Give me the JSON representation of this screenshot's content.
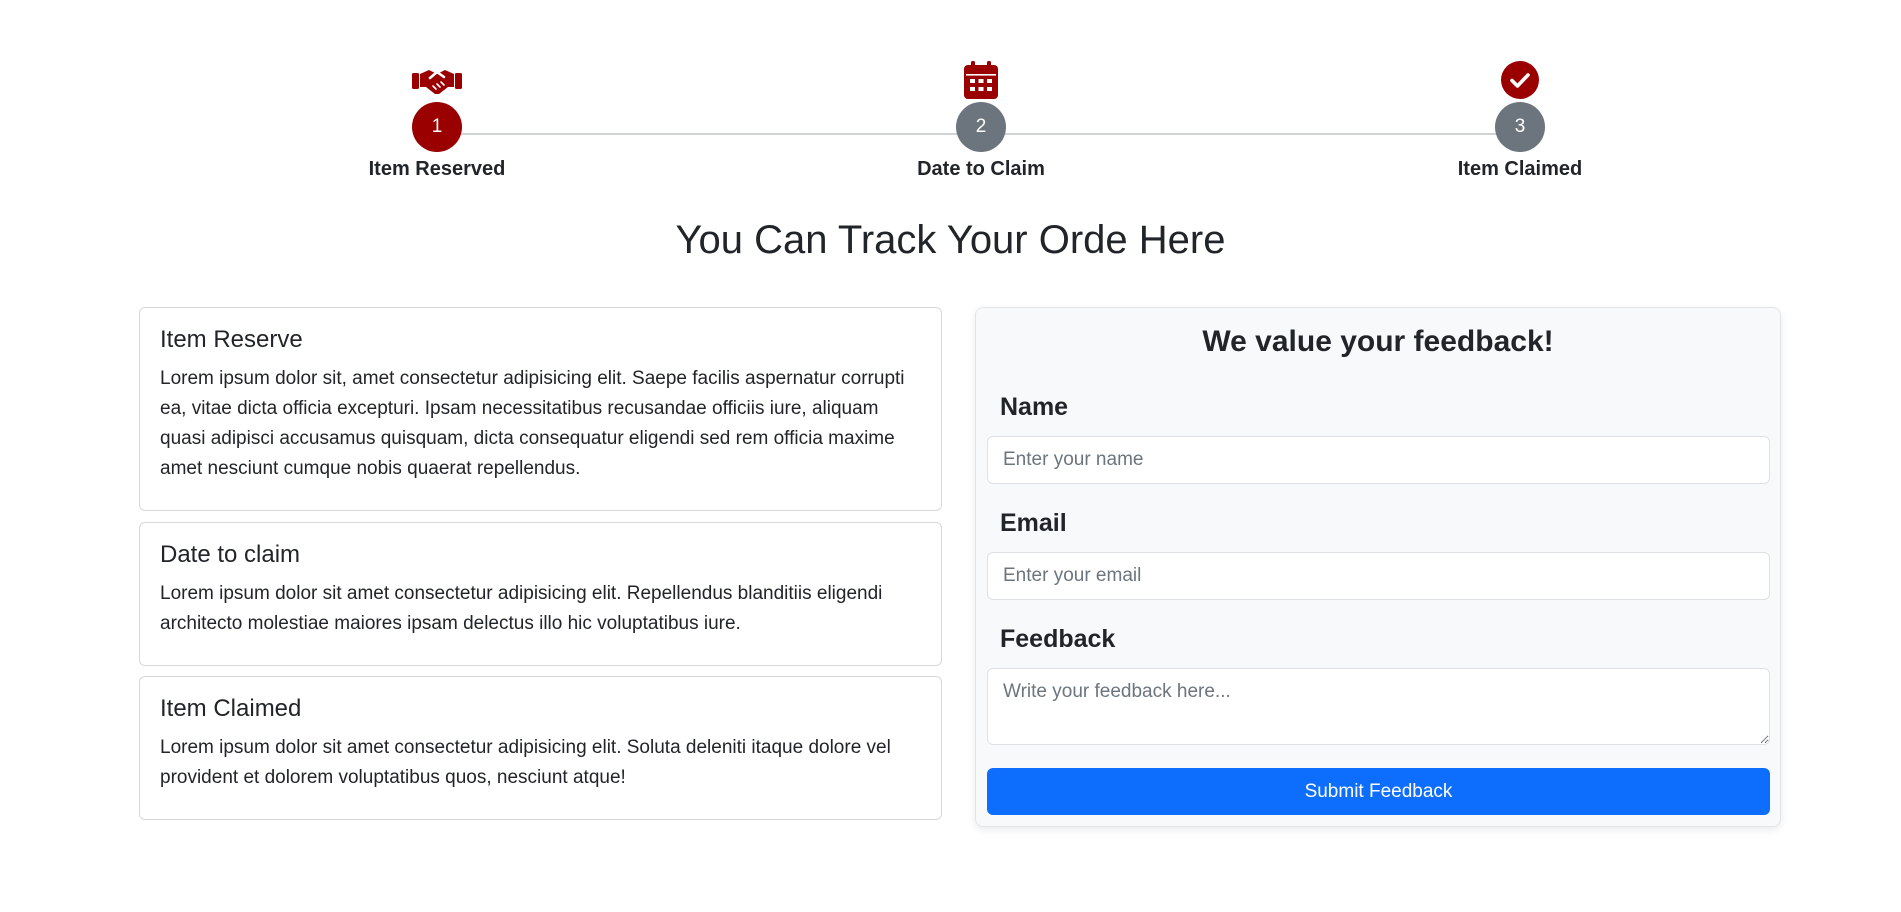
{
  "stepper": {
    "steps": [
      {
        "number": "1",
        "label": "Item Reserved",
        "icon": "handshake-icon",
        "state": "active"
      },
      {
        "number": "2",
        "label": "Date to Claim",
        "icon": "calendar-icon",
        "state": "pending"
      },
      {
        "number": "3",
        "label": "Item Claimed",
        "icon": "check-circle-icon",
        "state": "pending"
      }
    ]
  },
  "colors": {
    "accent": "#9b0000",
    "pending": "#6c757d",
    "primary_button": "#0d6efd"
  },
  "page": {
    "title": "You Can Track Your Orde Here"
  },
  "cards": [
    {
      "title": "Item Reserve",
      "text": "Lorem ipsum dolor sit, amet consectetur adipisicing elit. Saepe facilis aspernatur corrupti ea, vitae dicta officia excepturi. Ipsam necessitatibus recusandae officiis iure, aliquam quasi adipisci accusamus quisquam, dicta consequatur eligendi sed rem officia maxime amet nesciunt cumque nobis quaerat repellendus."
    },
    {
      "title": "Date to claim",
      "text": "Lorem ipsum dolor sit amet consectetur adipisicing elit. Repellendus blanditiis eligendi architecto molestiae maiores ipsam delectus illo hic voluptatibus iure."
    },
    {
      "title": "Item Claimed",
      "text": "Lorem ipsum dolor sit amet consectetur adipisicing elit. Soluta deleniti itaque dolore vel provident et dolorem voluptatibus quos, nesciunt atque!"
    }
  ],
  "feedback": {
    "title": "We value your feedback!",
    "name_label": "Name",
    "name_placeholder": "Enter your name",
    "name_value": "",
    "email_label": "Email",
    "email_placeholder": "Enter your email",
    "email_value": "",
    "feedback_label": "Feedback",
    "feedback_placeholder": "Write your feedback here...",
    "feedback_value": "",
    "submit_label": "Submit Feedback"
  }
}
